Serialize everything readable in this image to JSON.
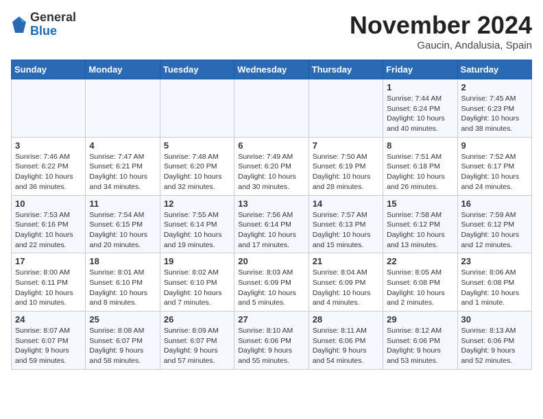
{
  "header": {
    "logo_general": "General",
    "logo_blue": "Blue",
    "month_title": "November 2024",
    "location": "Gaucin, Andalusia, Spain"
  },
  "weekdays": [
    "Sunday",
    "Monday",
    "Tuesday",
    "Wednesday",
    "Thursday",
    "Friday",
    "Saturday"
  ],
  "weeks": [
    [
      {
        "day": "",
        "info": ""
      },
      {
        "day": "",
        "info": ""
      },
      {
        "day": "",
        "info": ""
      },
      {
        "day": "",
        "info": ""
      },
      {
        "day": "",
        "info": ""
      },
      {
        "day": "1",
        "info": "Sunrise: 7:44 AM\nSunset: 6:24 PM\nDaylight: 10 hours and 40 minutes."
      },
      {
        "day": "2",
        "info": "Sunrise: 7:45 AM\nSunset: 6:23 PM\nDaylight: 10 hours and 38 minutes."
      }
    ],
    [
      {
        "day": "3",
        "info": "Sunrise: 7:46 AM\nSunset: 6:22 PM\nDaylight: 10 hours and 36 minutes."
      },
      {
        "day": "4",
        "info": "Sunrise: 7:47 AM\nSunset: 6:21 PM\nDaylight: 10 hours and 34 minutes."
      },
      {
        "day": "5",
        "info": "Sunrise: 7:48 AM\nSunset: 6:20 PM\nDaylight: 10 hours and 32 minutes."
      },
      {
        "day": "6",
        "info": "Sunrise: 7:49 AM\nSunset: 6:20 PM\nDaylight: 10 hours and 30 minutes."
      },
      {
        "day": "7",
        "info": "Sunrise: 7:50 AM\nSunset: 6:19 PM\nDaylight: 10 hours and 28 minutes."
      },
      {
        "day": "8",
        "info": "Sunrise: 7:51 AM\nSunset: 6:18 PM\nDaylight: 10 hours and 26 minutes."
      },
      {
        "day": "9",
        "info": "Sunrise: 7:52 AM\nSunset: 6:17 PM\nDaylight: 10 hours and 24 minutes."
      }
    ],
    [
      {
        "day": "10",
        "info": "Sunrise: 7:53 AM\nSunset: 6:16 PM\nDaylight: 10 hours and 22 minutes."
      },
      {
        "day": "11",
        "info": "Sunrise: 7:54 AM\nSunset: 6:15 PM\nDaylight: 10 hours and 20 minutes."
      },
      {
        "day": "12",
        "info": "Sunrise: 7:55 AM\nSunset: 6:14 PM\nDaylight: 10 hours and 19 minutes."
      },
      {
        "day": "13",
        "info": "Sunrise: 7:56 AM\nSunset: 6:14 PM\nDaylight: 10 hours and 17 minutes."
      },
      {
        "day": "14",
        "info": "Sunrise: 7:57 AM\nSunset: 6:13 PM\nDaylight: 10 hours and 15 minutes."
      },
      {
        "day": "15",
        "info": "Sunrise: 7:58 AM\nSunset: 6:12 PM\nDaylight: 10 hours and 13 minutes."
      },
      {
        "day": "16",
        "info": "Sunrise: 7:59 AM\nSunset: 6:12 PM\nDaylight: 10 hours and 12 minutes."
      }
    ],
    [
      {
        "day": "17",
        "info": "Sunrise: 8:00 AM\nSunset: 6:11 PM\nDaylight: 10 hours and 10 minutes."
      },
      {
        "day": "18",
        "info": "Sunrise: 8:01 AM\nSunset: 6:10 PM\nDaylight: 10 hours and 8 minutes."
      },
      {
        "day": "19",
        "info": "Sunrise: 8:02 AM\nSunset: 6:10 PM\nDaylight: 10 hours and 7 minutes."
      },
      {
        "day": "20",
        "info": "Sunrise: 8:03 AM\nSunset: 6:09 PM\nDaylight: 10 hours and 5 minutes."
      },
      {
        "day": "21",
        "info": "Sunrise: 8:04 AM\nSunset: 6:09 PM\nDaylight: 10 hours and 4 minutes."
      },
      {
        "day": "22",
        "info": "Sunrise: 8:05 AM\nSunset: 6:08 PM\nDaylight: 10 hours and 2 minutes."
      },
      {
        "day": "23",
        "info": "Sunrise: 8:06 AM\nSunset: 6:08 PM\nDaylight: 10 hours and 1 minute."
      }
    ],
    [
      {
        "day": "24",
        "info": "Sunrise: 8:07 AM\nSunset: 6:07 PM\nDaylight: 9 hours and 59 minutes."
      },
      {
        "day": "25",
        "info": "Sunrise: 8:08 AM\nSunset: 6:07 PM\nDaylight: 9 hours and 58 minutes."
      },
      {
        "day": "26",
        "info": "Sunrise: 8:09 AM\nSunset: 6:07 PM\nDaylight: 9 hours and 57 minutes."
      },
      {
        "day": "27",
        "info": "Sunrise: 8:10 AM\nSunset: 6:06 PM\nDaylight: 9 hours and 55 minutes."
      },
      {
        "day": "28",
        "info": "Sunrise: 8:11 AM\nSunset: 6:06 PM\nDaylight: 9 hours and 54 minutes."
      },
      {
        "day": "29",
        "info": "Sunrise: 8:12 AM\nSunset: 6:06 PM\nDaylight: 9 hours and 53 minutes."
      },
      {
        "day": "30",
        "info": "Sunrise: 8:13 AM\nSunset: 6:06 PM\nDaylight: 9 hours and 52 minutes."
      }
    ]
  ]
}
